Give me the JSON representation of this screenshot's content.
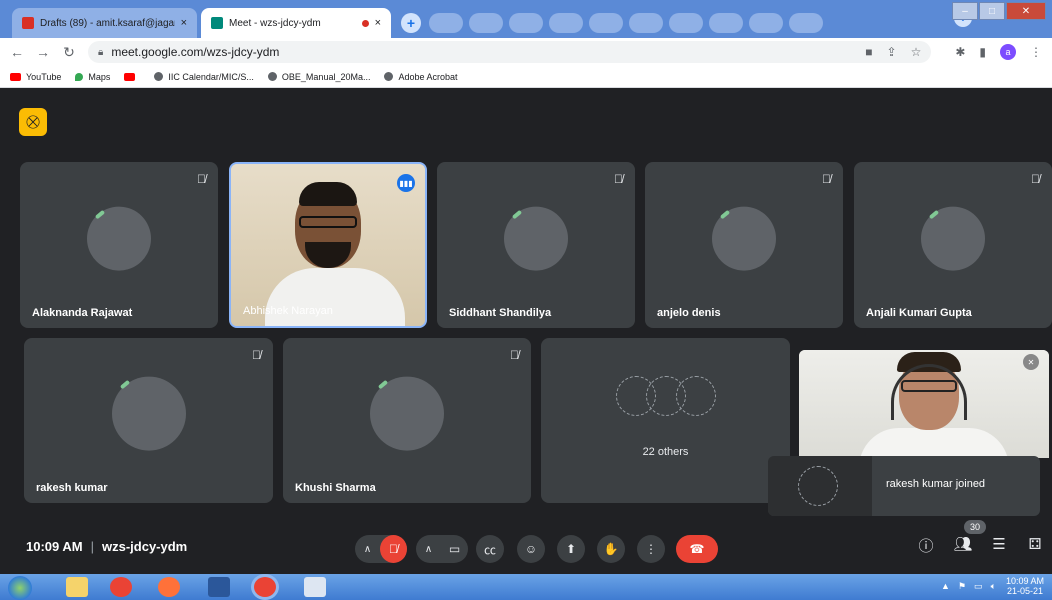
{
  "browser": {
    "tabs": [
      {
        "label": "Drafts (89) - amit.ksaraf@jaganna",
        "close": "×",
        "icon_color": "#d93025"
      },
      {
        "label": "Meet - wzs-jdcy-ydm",
        "close": "×",
        "icon_color": "#00897b"
      }
    ],
    "new_tab": "+",
    "url": "meet.google.com/wzs-jdcy-ydm",
    "profile_initial": "a",
    "bookmarks": [
      {
        "label": "YouTube",
        "color": "#ff0000"
      },
      {
        "label": "Maps",
        "color": "#34a853"
      },
      {
        "label": "",
        "color": "#ff0000"
      },
      {
        "label": "IIC Calendar/MIC/S...",
        "color": "#202124"
      },
      {
        "label": "OBE_Manual_20Ma...",
        "color": "#202124"
      },
      {
        "label": "Adobe Acrobat",
        "color": "#202124"
      }
    ]
  },
  "meet": {
    "participants_row1": [
      {
        "name": "Alaknanda Rajawat",
        "muted": true
      },
      {
        "name": "Abhishek Narayan",
        "video": true,
        "speaking": true
      },
      {
        "name": "Siddhant Shandilya",
        "muted": true
      },
      {
        "name": "anjelo denis",
        "muted": true
      },
      {
        "name": "Anjali Kumari Gupta",
        "muted": true
      }
    ],
    "participants_row2": [
      {
        "name": "rakesh kumar",
        "muted": true
      },
      {
        "name": "Khushi Sharma",
        "muted": true
      }
    ],
    "others_label": "22 others",
    "toast": "rakesh kumar joined",
    "time": "10:09 AM",
    "separator": "|",
    "meeting_code": "wzs-jdcy-ydm",
    "participant_count": "30"
  },
  "taskbar": {
    "time": "10:09 AM",
    "date": "21-05-21"
  },
  "colors": {
    "accent_red": "#ea4335",
    "meet_bg": "#202124",
    "tile_bg": "#3c4043",
    "host_badge": "#fbbc04"
  }
}
